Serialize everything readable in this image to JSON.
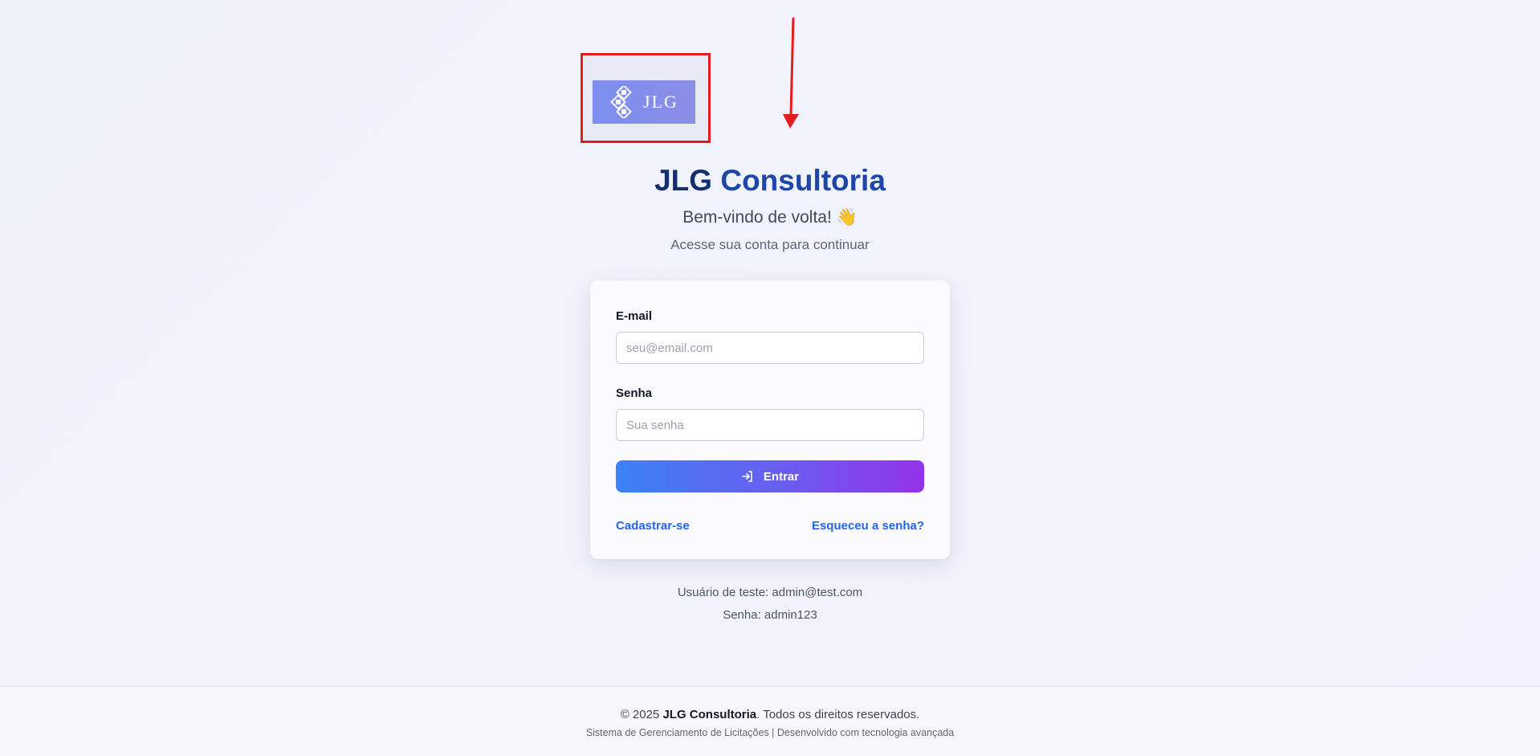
{
  "brand": {
    "logo_text": "JLG",
    "title_part1": "JLG",
    "title_part2": "Consultoria"
  },
  "header": {
    "welcome": "Bem-vindo de volta! 👋",
    "subtitle": "Acesse sua conta para continuar"
  },
  "form": {
    "email_label": "E-mail",
    "email_placeholder": "seu@email.com",
    "email_value": "",
    "password_label": "Senha",
    "password_placeholder": "Sua senha",
    "password_value": "",
    "submit_label": "Entrar",
    "submit_icon": "login-icon",
    "register_link": "Cadastrar-se",
    "forgot_link": "Esqueceu a senha?"
  },
  "test_user": {
    "line1": "Usuário de teste: admin@test.com",
    "line2": "Senha: admin123"
  },
  "footer": {
    "copyright_prefix": "© 2025",
    "company": "JLG Consultoria",
    "copyright_suffix": ". Todos os direitos reservados.",
    "tagline": "Sistema de Gerenciamento de Licitações | Desenvolvido com tecnologia avançada"
  },
  "colors": {
    "title_dark": "#16306e",
    "title_accent": "#1e46a8",
    "link": "#2563eb",
    "button_gradient_start": "#3b82f6",
    "button_gradient_end": "#9333ea",
    "annotation": "#e21d1d"
  }
}
